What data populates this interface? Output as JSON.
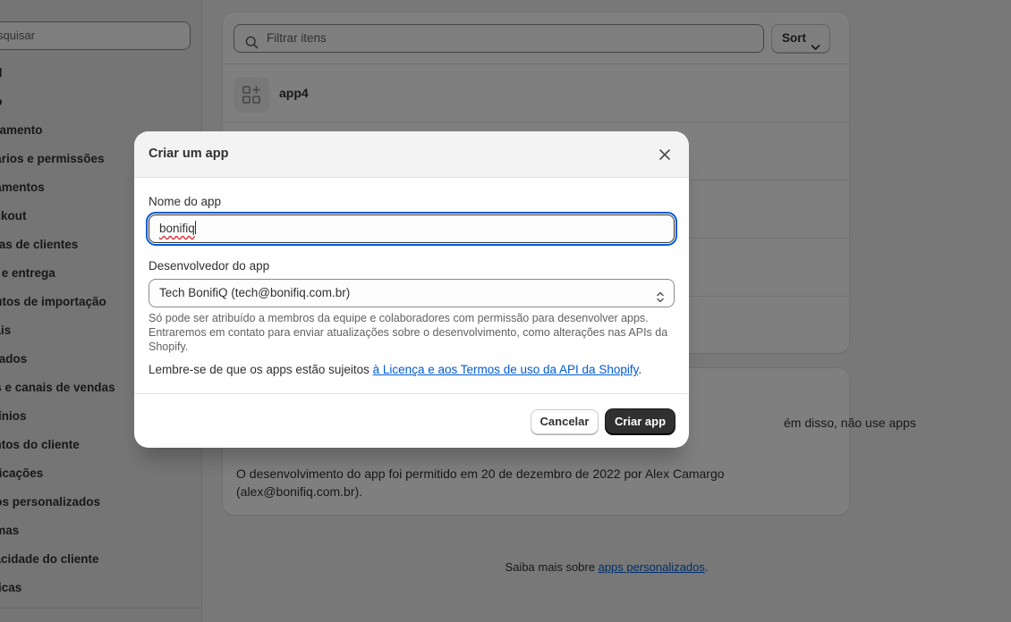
{
  "sidebar": {
    "search_placeholder": "squisar",
    "items": [
      {
        "label": "ral"
      },
      {
        "label": "no"
      },
      {
        "label": "uramento"
      },
      {
        "label": "uários e permissões"
      },
      {
        "label": "gamentos"
      },
      {
        "label": "eckout"
      },
      {
        "label": "ntas de clientes"
      },
      {
        "label": "te e entrega"
      },
      {
        "label": "butos de importação"
      },
      {
        "label": "cais"
      },
      {
        "label": "rcados"
      },
      {
        "label": "ps e canais de vendas"
      },
      {
        "label": "mínios"
      },
      {
        "label": "entos do cliente"
      },
      {
        "label": "tificações"
      },
      {
        "label": "dos personalizados"
      },
      {
        "label": "omas"
      },
      {
        "label": "vacidade do cliente"
      },
      {
        "label": "líticas"
      }
    ]
  },
  "main": {
    "filter_placeholder": "Filtrar itens",
    "sort_label": "Sort",
    "apps": [
      {
        "name": "app4"
      }
    ],
    "info_partial": "ém disso, não use apps",
    "dev_permission": "O desenvolvimento do app foi permitido em 20 de dezembro de 2022 por Alex Camargo (alex@bonifiq.com.br).",
    "footer_prefix": "Saiba mais sobre ",
    "footer_link": "apps personalizados",
    "footer_suffix": "."
  },
  "modal": {
    "title": "Criar um app",
    "name_label": "Nome do app",
    "name_value": "bonifiq",
    "developer_label": "Desenvolvedor do app",
    "developer_value": "Tech BonifiQ (tech@bonifiq.com.br)",
    "help_text": "Só pode ser atribuído a membros da equipe e colaboradores com permissão para desenvolver apps. Entraremos em contato para enviar atualizações sobre o desenvolvimento, como alterações nas APIs da Shopify.",
    "terms_prefix": "Lembre-se de que os apps estão sujeitos ",
    "terms_link": "à Licença e aos Termos de uso da API da Shopify",
    "terms_suffix": ".",
    "cancel_label": "Cancelar",
    "create_label": "Criar app"
  },
  "colors": {
    "overlay": "#00000080",
    "primary_button": "#303030",
    "link": "#005bd3",
    "focus_ring": "#005bd3"
  }
}
